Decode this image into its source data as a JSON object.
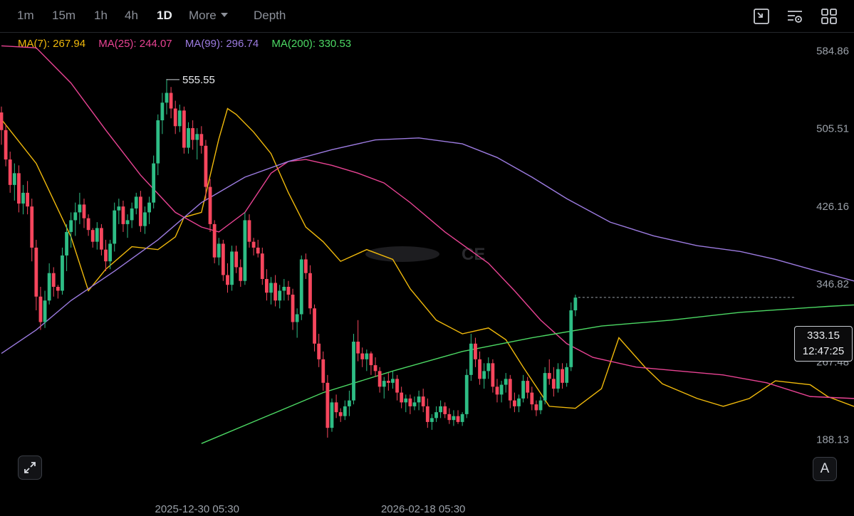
{
  "toolbar": {
    "intervals": [
      "1m",
      "15m",
      "1h",
      "4h",
      "1D"
    ],
    "active_interval": "1D",
    "more_label": "More",
    "depth_label": "Depth",
    "icons": [
      "fullscreen-exit-icon",
      "chart-settings-icon",
      "grid-layout-icon"
    ]
  },
  "ma_legend": [
    {
      "label": "MA(7):",
      "value": "267.94",
      "color": "#f0b90b"
    },
    {
      "label": "MA(25):",
      "value": "244.07",
      "color": "#e84393"
    },
    {
      "label": "MA(99):",
      "value": "296.74",
      "color": "#9c7be0"
    },
    {
      "label": "MA(200):",
      "value": "330.53",
      "color": "#4cd964"
    }
  ],
  "price_box": {
    "price": "333.15",
    "countdown": "12:47:25"
  },
  "peak_label": "555.55",
  "autoscale_label": "A",
  "watermark_text": "CE",
  "chart_data": {
    "type": "candlestick",
    "y_ticks": [
      "584.86",
      "505.51",
      "426.16",
      "346.82",
      "267.48",
      "188.13"
    ],
    "x_ticks": [
      "2025-12-30 05:30",
      "2026-02-18 05:30"
    ],
    "ylim": [
      182,
      600
    ],
    "colors": {
      "up": "#2ebd85",
      "down": "#f6465d"
    },
    "candles": [
      [
        522,
        528,
        489,
        504
      ],
      [
        504,
        510,
        467,
        474
      ],
      [
        474,
        482,
        440,
        448
      ],
      [
        448,
        470,
        432,
        460
      ],
      [
        460,
        468,
        420,
        429
      ],
      [
        429,
        448,
        418,
        440
      ],
      [
        440,
        452,
        418,
        426
      ],
      [
        426,
        434,
        370,
        384
      ],
      [
        384,
        392,
        320,
        334
      ],
      [
        334,
        344,
        300,
        308
      ],
      [
        308,
        340,
        302,
        330
      ],
      [
        330,
        368,
        326,
        358
      ],
      [
        358,
        364,
        334,
        344
      ],
      [
        344,
        346,
        332,
        340
      ],
      [
        340,
        384,
        336,
        376
      ],
      [
        376,
        408,
        360,
        400
      ],
      [
        400,
        420,
        384,
        412
      ],
      [
        412,
        430,
        396,
        420
      ],
      [
        420,
        440,
        408,
        428
      ],
      [
        428,
        434,
        404,
        414
      ],
      [
        414,
        418,
        396,
        402
      ],
      [
        402,
        404,
        384,
        390
      ],
      [
        390,
        410,
        382,
        404
      ],
      [
        404,
        408,
        376,
        382
      ],
      [
        382,
        392,
        360,
        370
      ],
      [
        370,
        392,
        362,
        388
      ],
      [
        388,
        430,
        380,
        422
      ],
      [
        422,
        434,
        408,
        426
      ],
      [
        426,
        432,
        400,
        408
      ],
      [
        408,
        418,
        394,
        412
      ],
      [
        412,
        430,
        404,
        424
      ],
      [
        424,
        440,
        418,
        436
      ],
      [
        436,
        442,
        400,
        406
      ],
      [
        406,
        426,
        398,
        420
      ],
      [
        420,
        436,
        408,
        430
      ],
      [
        430,
        478,
        424,
        470
      ],
      [
        470,
        520,
        458,
        514
      ],
      [
        514,
        542,
        500,
        532
      ],
      [
        532,
        556,
        520,
        542
      ],
      [
        542,
        548,
        516,
        526
      ],
      [
        526,
        534,
        500,
        508
      ],
      [
        508,
        530,
        502,
        524
      ],
      [
        524,
        528,
        480,
        486
      ],
      [
        486,
        512,
        480,
        506
      ],
      [
        506,
        514,
        484,
        494
      ],
      [
        494,
        506,
        474,
        500
      ],
      [
        500,
        508,
        480,
        488
      ],
      [
        488,
        494,
        432,
        446
      ],
      [
        446,
        454,
        400,
        408
      ],
      [
        408,
        412,
        368,
        374
      ],
      [
        374,
        394,
        366,
        388
      ],
      [
        388,
        392,
        350,
        356
      ],
      [
        356,
        368,
        338,
        346
      ],
      [
        346,
        386,
        340,
        380
      ],
      [
        380,
        386,
        358,
        364
      ],
      [
        364,
        372,
        344,
        350
      ],
      [
        350,
        420,
        346,
        412
      ],
      [
        412,
        418,
        384,
        390
      ],
      [
        390,
        394,
        376,
        384
      ],
      [
        384,
        392,
        374,
        378
      ],
      [
        378,
        384,
        346,
        352
      ],
      [
        352,
        362,
        330,
        338
      ],
      [
        338,
        354,
        326,
        348
      ],
      [
        348,
        356,
        324,
        330
      ],
      [
        330,
        346,
        322,
        340
      ],
      [
        340,
        352,
        330,
        344
      ],
      [
        344,
        350,
        330,
        336
      ],
      [
        336,
        342,
        300,
        308
      ],
      [
        308,
        322,
        292,
        316
      ],
      [
        316,
        376,
        310,
        372
      ],
      [
        372,
        378,
        352,
        358
      ],
      [
        358,
        366,
        316,
        322
      ],
      [
        322,
        326,
        278,
        286
      ],
      [
        286,
        296,
        262,
        270
      ],
      [
        270,
        278,
        238,
        246
      ],
      [
        246,
        254,
        190,
        200
      ],
      [
        200,
        230,
        196,
        226
      ],
      [
        226,
        234,
        210,
        216
      ],
      [
        216,
        220,
        206,
        212
      ],
      [
        212,
        228,
        208,
        222
      ],
      [
        222,
        238,
        212,
        228
      ],
      [
        228,
        296,
        224,
        288
      ],
      [
        288,
        310,
        268,
        276
      ],
      [
        276,
        282,
        262,
        270
      ],
      [
        270,
        280,
        258,
        276
      ],
      [
        276,
        278,
        254,
        264
      ],
      [
        264,
        272,
        252,
        258
      ],
      [
        258,
        262,
        236,
        242
      ],
      [
        242,
        252,
        230,
        248
      ],
      [
        248,
        256,
        238,
        246
      ],
      [
        246,
        258,
        240,
        250
      ],
      [
        250,
        254,
        228,
        236
      ],
      [
        236,
        242,
        220,
        226
      ],
      [
        226,
        234,
        216,
        230
      ],
      [
        230,
        234,
        214,
        222
      ],
      [
        222,
        232,
        218,
        226
      ],
      [
        226,
        238,
        218,
        232
      ],
      [
        232,
        240,
        216,
        222
      ],
      [
        222,
        230,
        200,
        206
      ],
      [
        206,
        214,
        198,
        210
      ],
      [
        210,
        222,
        206,
        216
      ],
      [
        216,
        228,
        210,
        222
      ],
      [
        222,
        226,
        210,
        214
      ],
      [
        214,
        220,
        204,
        208
      ],
      [
        208,
        218,
        202,
        212
      ],
      [
        212,
        218,
        204,
        206
      ],
      [
        206,
        216,
        202,
        214
      ],
      [
        214,
        260,
        210,
        254
      ],
      [
        254,
        296,
        248,
        286
      ],
      [
        286,
        292,
        262,
        270
      ],
      [
        270,
        278,
        244,
        250
      ],
      [
        250,
        266,
        240,
        258
      ],
      [
        258,
        272,
        250,
        266
      ],
      [
        266,
        270,
        236,
        242
      ],
      [
        242,
        250,
        226,
        234
      ],
      [
        234,
        248,
        226,
        244
      ],
      [
        244,
        256,
        236,
        250
      ],
      [
        250,
        254,
        220,
        228
      ],
      [
        228,
        236,
        216,
        222
      ],
      [
        222,
        234,
        216,
        230
      ],
      [
        230,
        254,
        226,
        248
      ],
      [
        248,
        252,
        230,
        236
      ],
      [
        236,
        242,
        218,
        224
      ],
      [
        224,
        228,
        212,
        218
      ],
      [
        218,
        232,
        214,
        228
      ],
      [
        228,
        262,
        224,
        256
      ],
      [
        256,
        270,
        244,
        250
      ],
      [
        250,
        262,
        232,
        240
      ],
      [
        240,
        266,
        236,
        260
      ],
      [
        260,
        266,
        240,
        246
      ],
      [
        246,
        266,
        242,
        262
      ],
      [
        262,
        328,
        258,
        320
      ],
      [
        320,
        336,
        314,
        333
      ]
    ],
    "ma_lines": [
      {
        "name": "MA(7)",
        "color": "#f0b90b",
        "points": [
          [
            0,
            515
          ],
          [
            8,
            470
          ],
          [
            16,
            395
          ],
          [
            20,
            340
          ],
          [
            24,
            362
          ],
          [
            30,
            385
          ],
          [
            36,
            382
          ],
          [
            40,
            395
          ],
          [
            42,
            415
          ],
          [
            46,
            420
          ],
          [
            50,
            495
          ],
          [
            52,
            526
          ],
          [
            54,
            520
          ],
          [
            58,
            502
          ],
          [
            62,
            480
          ],
          [
            66,
            440
          ],
          [
            70,
            405
          ],
          [
            74,
            390
          ],
          [
            78,
            370
          ],
          [
            84,
            382
          ],
          [
            90,
            372
          ],
          [
            94,
            342
          ],
          [
            100,
            310
          ],
          [
            106,
            296
          ],
          [
            112,
            302
          ],
          [
            116,
            290
          ],
          [
            120,
            262
          ],
          [
            126,
            222
          ],
          [
            132,
            220
          ],
          [
            138,
            240
          ],
          [
            142,
            292
          ],
          [
            148,
            262
          ],
          [
            152,
            245
          ],
          [
            160,
            230
          ],
          [
            166,
            222
          ],
          [
            172,
            230
          ],
          [
            178,
            248
          ],
          [
            186,
            244
          ],
          [
            190,
            232
          ],
          [
            196,
            222
          ],
          [
            202,
            220
          ],
          [
            206,
            226
          ],
          [
            210,
            236
          ],
          [
            214,
            240
          ],
          [
            220,
            236
          ],
          [
            226,
            232
          ],
          [
            232,
            262
          ],
          [
            236,
            280
          ]
        ]
      },
      {
        "name": "MA(25)",
        "color": "#e84393",
        "points": [
          [
            0,
            590
          ],
          [
            8,
            588
          ],
          [
            16,
            552
          ],
          [
            24,
            504
          ],
          [
            32,
            458
          ],
          [
            40,
            420
          ],
          [
            46,
            405
          ],
          [
            50,
            400
          ],
          [
            56,
            420
          ],
          [
            62,
            460
          ],
          [
            66,
            472
          ],
          [
            70,
            474
          ],
          [
            76,
            468
          ],
          [
            82,
            460
          ],
          [
            88,
            450
          ],
          [
            94,
            430
          ],
          [
            102,
            400
          ],
          [
            112,
            368
          ],
          [
            118,
            340
          ],
          [
            124,
            310
          ],
          [
            130,
            286
          ],
          [
            136,
            272
          ],
          [
            146,
            262
          ],
          [
            156,
            258
          ],
          [
            166,
            254
          ],
          [
            176,
            246
          ],
          [
            186,
            232
          ],
          [
            196,
            230
          ],
          [
            206,
            226
          ],
          [
            214,
            226
          ],
          [
            222,
            224
          ],
          [
            228,
            232
          ],
          [
            236,
            242
          ]
        ]
      },
      {
        "name": "MA(99)",
        "color": "#9c7be0",
        "points": [
          [
            0,
            276
          ],
          [
            8,
            300
          ],
          [
            16,
            330
          ],
          [
            26,
            360
          ],
          [
            36,
            392
          ],
          [
            46,
            430
          ],
          [
            56,
            456
          ],
          [
            66,
            472
          ],
          [
            76,
            484
          ],
          [
            86,
            494
          ],
          [
            96,
            496
          ],
          [
            106,
            490
          ],
          [
            114,
            476
          ],
          [
            122,
            456
          ],
          [
            130,
            434
          ],
          [
            140,
            410
          ],
          [
            150,
            396
          ],
          [
            160,
            386
          ],
          [
            170,
            380
          ],
          [
            178,
            372
          ],
          [
            186,
            362
          ],
          [
            196,
            350
          ],
          [
            206,
            340
          ],
          [
            214,
            330
          ],
          [
            222,
            320
          ],
          [
            228,
            312
          ],
          [
            236,
            300
          ]
        ]
      },
      {
        "name": "MA(200)",
        "color": "#4cd964",
        "points": [
          [
            46,
            184
          ],
          [
            60,
            210
          ],
          [
            74,
            236
          ],
          [
            90,
            258
          ],
          [
            106,
            278
          ],
          [
            122,
            292
          ],
          [
            138,
            304
          ],
          [
            154,
            310
          ],
          [
            170,
            318
          ],
          [
            190,
            324
          ],
          [
            210,
            329
          ],
          [
            236,
            338
          ]
        ]
      }
    ]
  }
}
